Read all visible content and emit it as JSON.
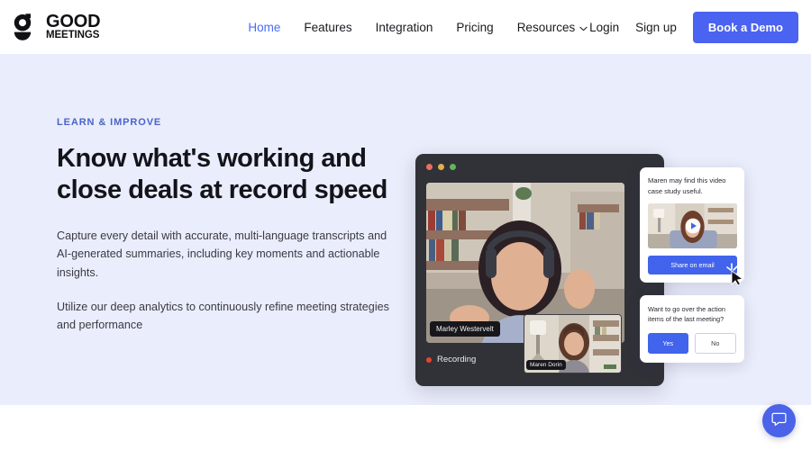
{
  "brand": {
    "logo_icon": "goodmeetings-g-mark-icon",
    "name_line1": "GOOD",
    "name_line2": "MEETINGS",
    "accent_blue": "#4a63f0",
    "hero_bg": "#eaedfb"
  },
  "nav": {
    "items": [
      {
        "label": "Home",
        "active": true,
        "has_chevron": false
      },
      {
        "label": "Features",
        "active": false,
        "has_chevron": false
      },
      {
        "label": "Integration",
        "active": false,
        "has_chevron": false
      },
      {
        "label": "Pricing",
        "active": false,
        "has_chevron": false
      },
      {
        "label": "Resources",
        "active": false,
        "has_chevron": true
      }
    ],
    "login_label": "Login",
    "signup_label": "Sign up",
    "demo_label": "Book a Demo"
  },
  "hero": {
    "eyebrow": "LEARN & IMPROVE",
    "headline": "Know what's working and close deals at record speed",
    "paragraph1": "Capture every detail with accurate, multi-language transcripts and AI-generated summaries, including key moments and actionable insights.",
    "paragraph2": "Utilize our deep analytics to continuously refine meeting strategies and performance"
  },
  "mockup": {
    "window_dots": [
      "red",
      "yellow",
      "green"
    ],
    "main_speaker_name": "Marley Westervelt",
    "pip_speaker_name": "Maren Dorin",
    "recording_label": "Recording",
    "recording_dot_color": "#e8442f"
  },
  "panel_video": {
    "message": "Maren may find this video case study useful.",
    "play_icon": "play-icon",
    "button_label": "Share on email"
  },
  "panel_question": {
    "message": "Want to go over the action items of the last meeting?",
    "yes_label": "Yes",
    "no_label": "No"
  },
  "chat": {
    "icon": "chat-bubble-icon"
  }
}
